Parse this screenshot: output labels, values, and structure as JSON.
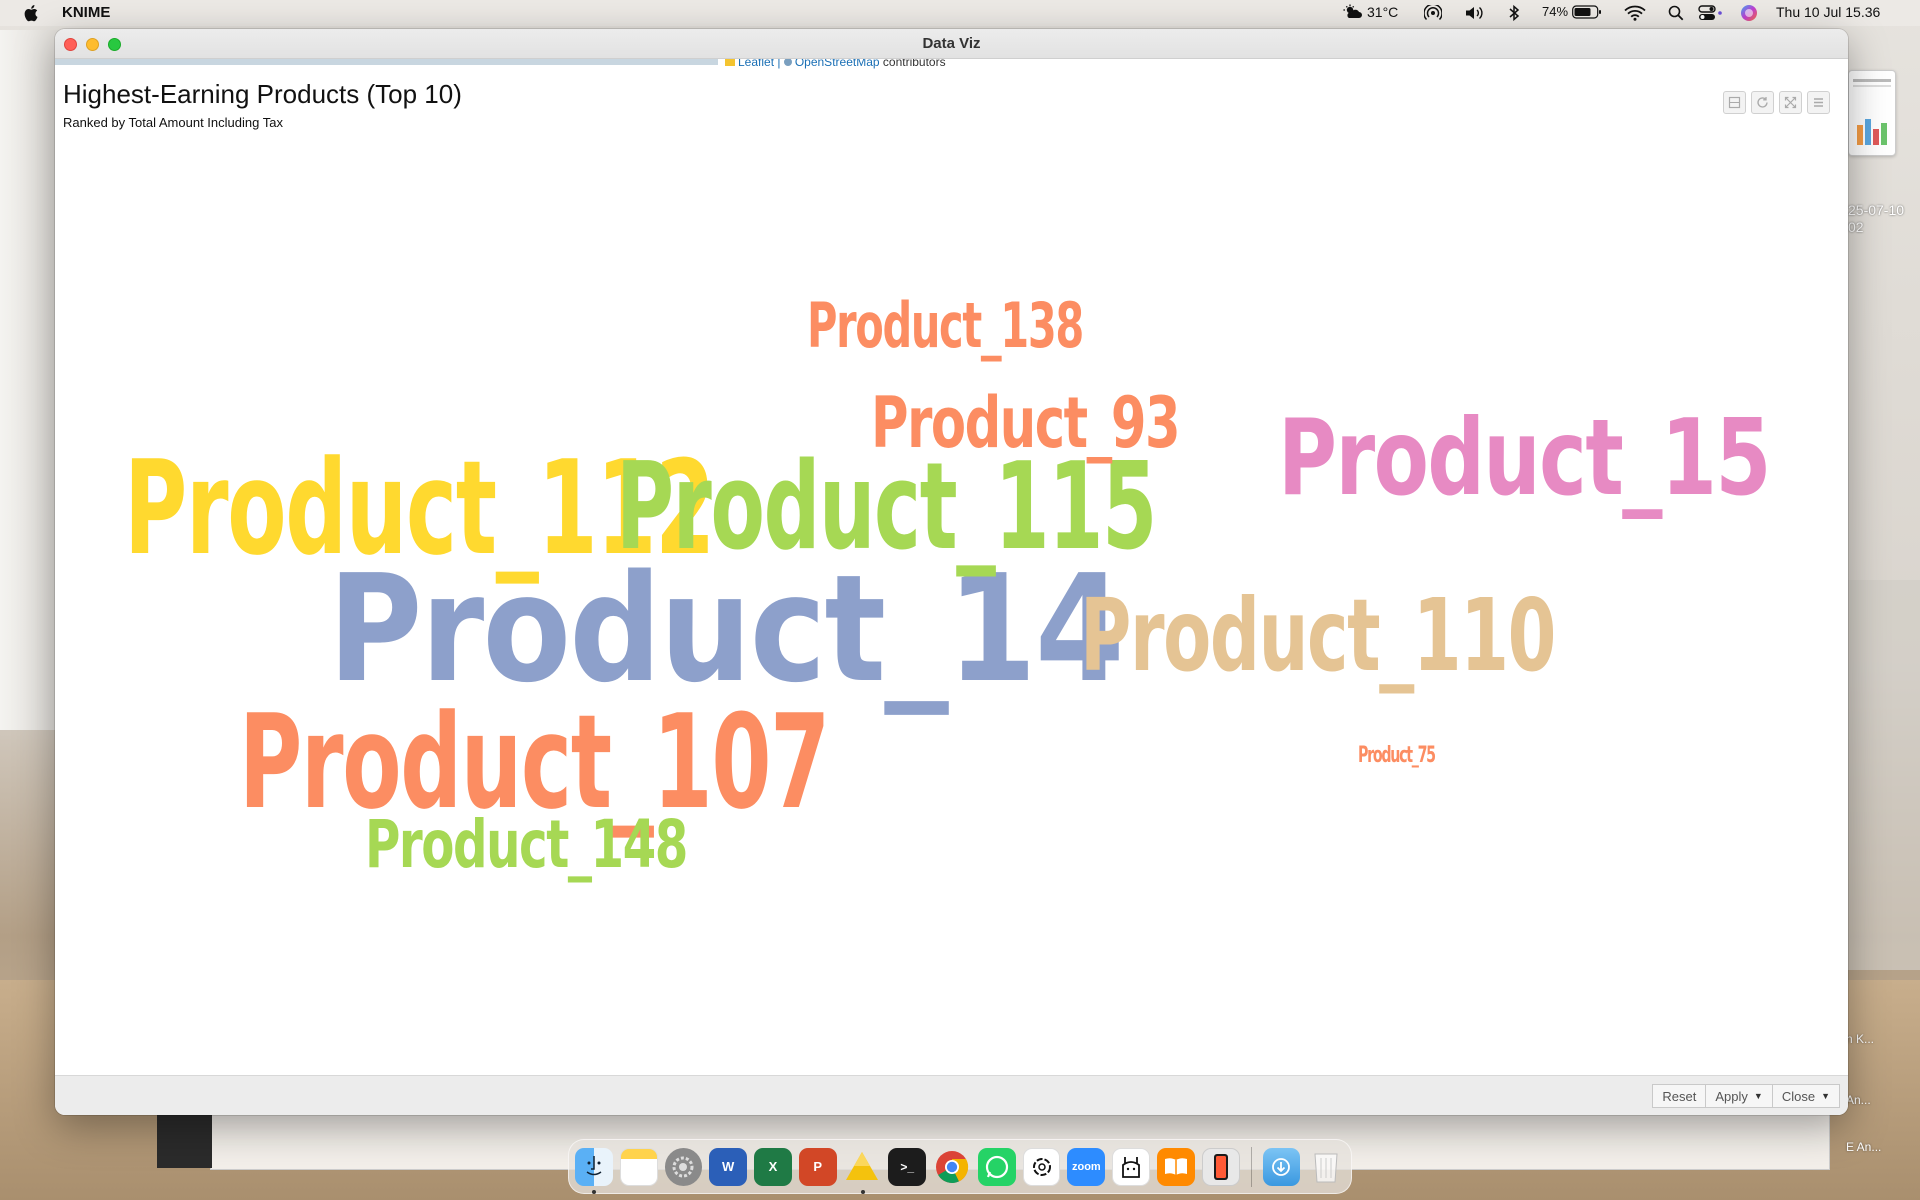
{
  "menubar": {
    "app_name": "KNIME",
    "weather": "31°C",
    "battery": "74%",
    "datetime": "Thu 10 Jul  15.36"
  },
  "desktop": {
    "date_fragment_1": "25-07-10",
    "date_fragment_2": "02",
    "side_item_1": "n K...",
    "side_item_2": "An...",
    "side_item_3": "E An..."
  },
  "window": {
    "title": "Data Viz",
    "map_attribution": {
      "leaflet": "Leaflet",
      "osm": "OpenStreetMap",
      "rest": "contributors"
    },
    "viz_title": "Highest-Earning Products (Top 10)",
    "viz_subtitle": "Ranked by Total Amount Including Tax",
    "bottom_buttons": {
      "reset": "Reset",
      "apply": "Apply",
      "close": "Close"
    }
  },
  "chart_data": {
    "type": "wordcloud",
    "title": "Highest-Earning Products (Top 10)",
    "subtitle": "Ranked by Total Amount Including Tax",
    "words": [
      {
        "text": "Product_14",
        "weight": 1.0,
        "color": "#8da0cb"
      },
      {
        "text": "Product_112",
        "weight": 0.78,
        "color": "#ffd92f"
      },
      {
        "text": "Product_115",
        "weight": 0.72,
        "color": "#a6d854"
      },
      {
        "text": "Product_107",
        "weight": 0.72,
        "color": "#fc8d62"
      },
      {
        "text": "Product_15",
        "weight": 0.66,
        "color": "#e78ac3"
      },
      {
        "text": "Product_110",
        "weight": 0.6,
        "color": "#e5c494"
      },
      {
        "text": "Product_93",
        "weight": 0.44,
        "color": "#fc8d62"
      },
      {
        "text": "Product_148",
        "weight": 0.44,
        "color": "#a6d854"
      },
      {
        "text": "Product_138",
        "weight": 0.4,
        "color": "#fc8d62"
      },
      {
        "text": "Product_75",
        "weight": 0.12,
        "color": "#fc8d62"
      }
    ]
  },
  "dock": {
    "apps": [
      "finder-icon",
      "notes-icon",
      "system-settings-icon",
      "word-icon",
      "excel-icon",
      "powerpoint-icon",
      "drive-icon",
      "terminal-icon",
      "chrome-icon",
      "whatsapp-icon",
      "chatgpt-icon",
      "zoom-icon",
      "ollama-icon",
      "books-icon",
      "iphone-mirroring-icon",
      "downloads-folder-icon",
      "trash-icon"
    ],
    "zoom_label": "zoom"
  }
}
